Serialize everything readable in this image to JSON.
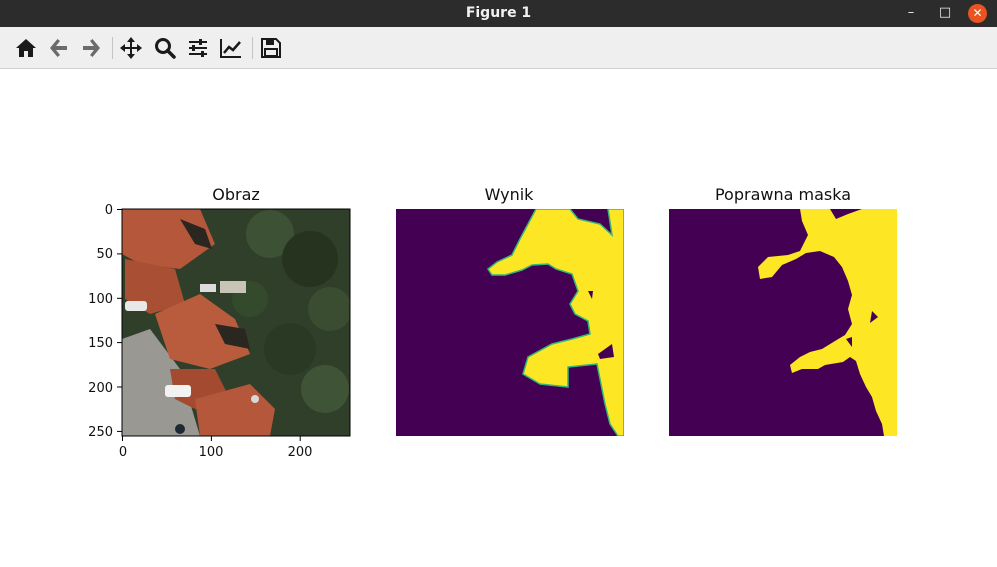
{
  "window": {
    "title": "Figure 1",
    "minimize_label": "–",
    "maximize_label": "□",
    "close_label": "✕"
  },
  "toolbar": {
    "buttons": [
      {
        "name": "home",
        "icon": "home-icon"
      },
      {
        "name": "back",
        "icon": "arrow-left-icon"
      },
      {
        "name": "forward",
        "icon": "arrow-right-icon"
      },
      {
        "name": "pan",
        "icon": "move-icon"
      },
      {
        "name": "zoom",
        "icon": "magnifier-icon"
      },
      {
        "name": "configure-subplots",
        "icon": "sliders-icon"
      },
      {
        "name": "edit-axis",
        "icon": "line-chart-icon"
      },
      {
        "name": "save",
        "icon": "floppy-icon"
      }
    ]
  },
  "figure": {
    "panels": [
      {
        "title": "Obraz"
      },
      {
        "title": "Wynik"
      },
      {
        "title": "Poprawna maska"
      }
    ],
    "yticks": [
      "0",
      "50",
      "100",
      "150",
      "200",
      "250"
    ],
    "xticks": [
      "0",
      "100",
      "200"
    ]
  },
  "colors": {
    "purple": "#440154",
    "yellow": "#fde725",
    "teal": "#35b779",
    "roof": "#b4573a",
    "trees": "#2f3f2a",
    "pavement": "#9a9893"
  }
}
